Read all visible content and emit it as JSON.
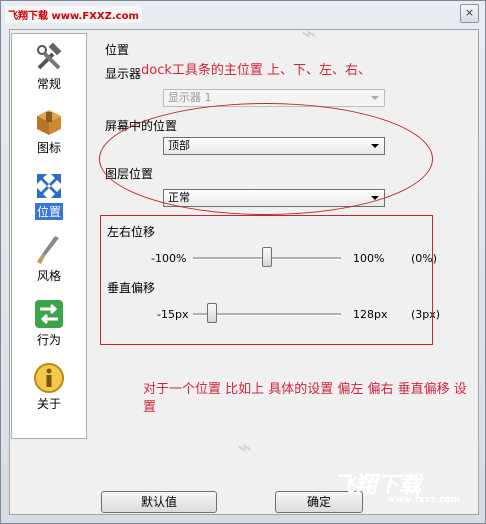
{
  "titlebar": {
    "watermark": "飞翔下载 www.FXXZ.com",
    "close_glyph": "×"
  },
  "sidebar": {
    "items": [
      {
        "label": "常规",
        "icon": "tools-icon"
      },
      {
        "label": "图标",
        "icon": "box-icon"
      },
      {
        "label": "位置",
        "icon": "arrows-icon"
      },
      {
        "label": "风格",
        "icon": "brush-icon"
      },
      {
        "label": "行为",
        "icon": "arrows-exchange-icon"
      },
      {
        "label": "关于",
        "icon": "info-icon"
      }
    ],
    "active_index": 2
  },
  "position": {
    "section_title": "位置",
    "display_label": "显示器",
    "display_value": "显示器 1",
    "screen_pos_label": "屏幕中的位置",
    "screen_pos_value": "顶部",
    "layer_label": "图层位置",
    "layer_value": "正常"
  },
  "offsets": {
    "h_label": "左右位移",
    "h_min": "-100%",
    "h_max": "100%",
    "h_value": "(0%)",
    "h_fraction": 0.5,
    "v_label": "垂直偏移",
    "v_min": "-15px",
    "v_max": "128px",
    "v_value": "(3px)",
    "v_fraction": 0.13
  },
  "annotations": {
    "top": "dock工具条的主位置 上、下、左、右、",
    "bottom": "对于一个位置 比如上 具体的设置 偏左 偏右 垂直偏移 设置"
  },
  "buttons": {
    "default_label": "默认值",
    "ok_label": "确定"
  },
  "watermark_bottom": {
    "text": "飞翔下载",
    "sub": "www.fxxz.com"
  },
  "colors": {
    "annotation_red": "#d4243a",
    "selection_blue": "#3875d6"
  }
}
